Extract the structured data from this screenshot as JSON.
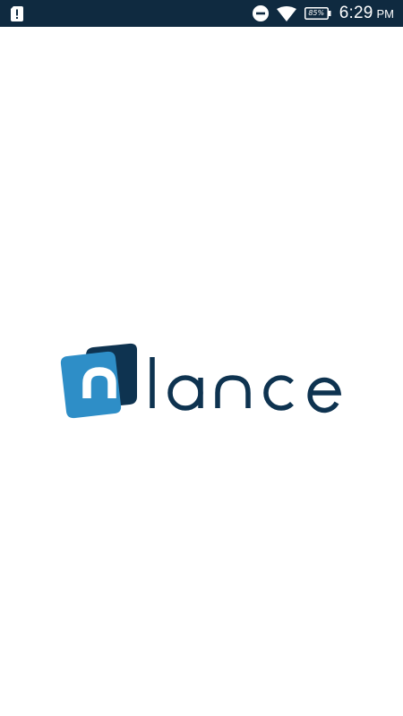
{
  "status_bar": {
    "time": "6:29",
    "ampm": "PM",
    "battery_text": "85%",
    "icons": [
      "notification-alert-icon",
      "do-not-disturb-icon",
      "wifi-icon",
      "battery-icon"
    ],
    "background": "#0f2a40"
  },
  "splash": {
    "logo_text": "nlance",
    "colors": {
      "dark_navy": "#0e3350",
      "light_blue": "#2e8ec7",
      "background": "#ffffff"
    }
  }
}
